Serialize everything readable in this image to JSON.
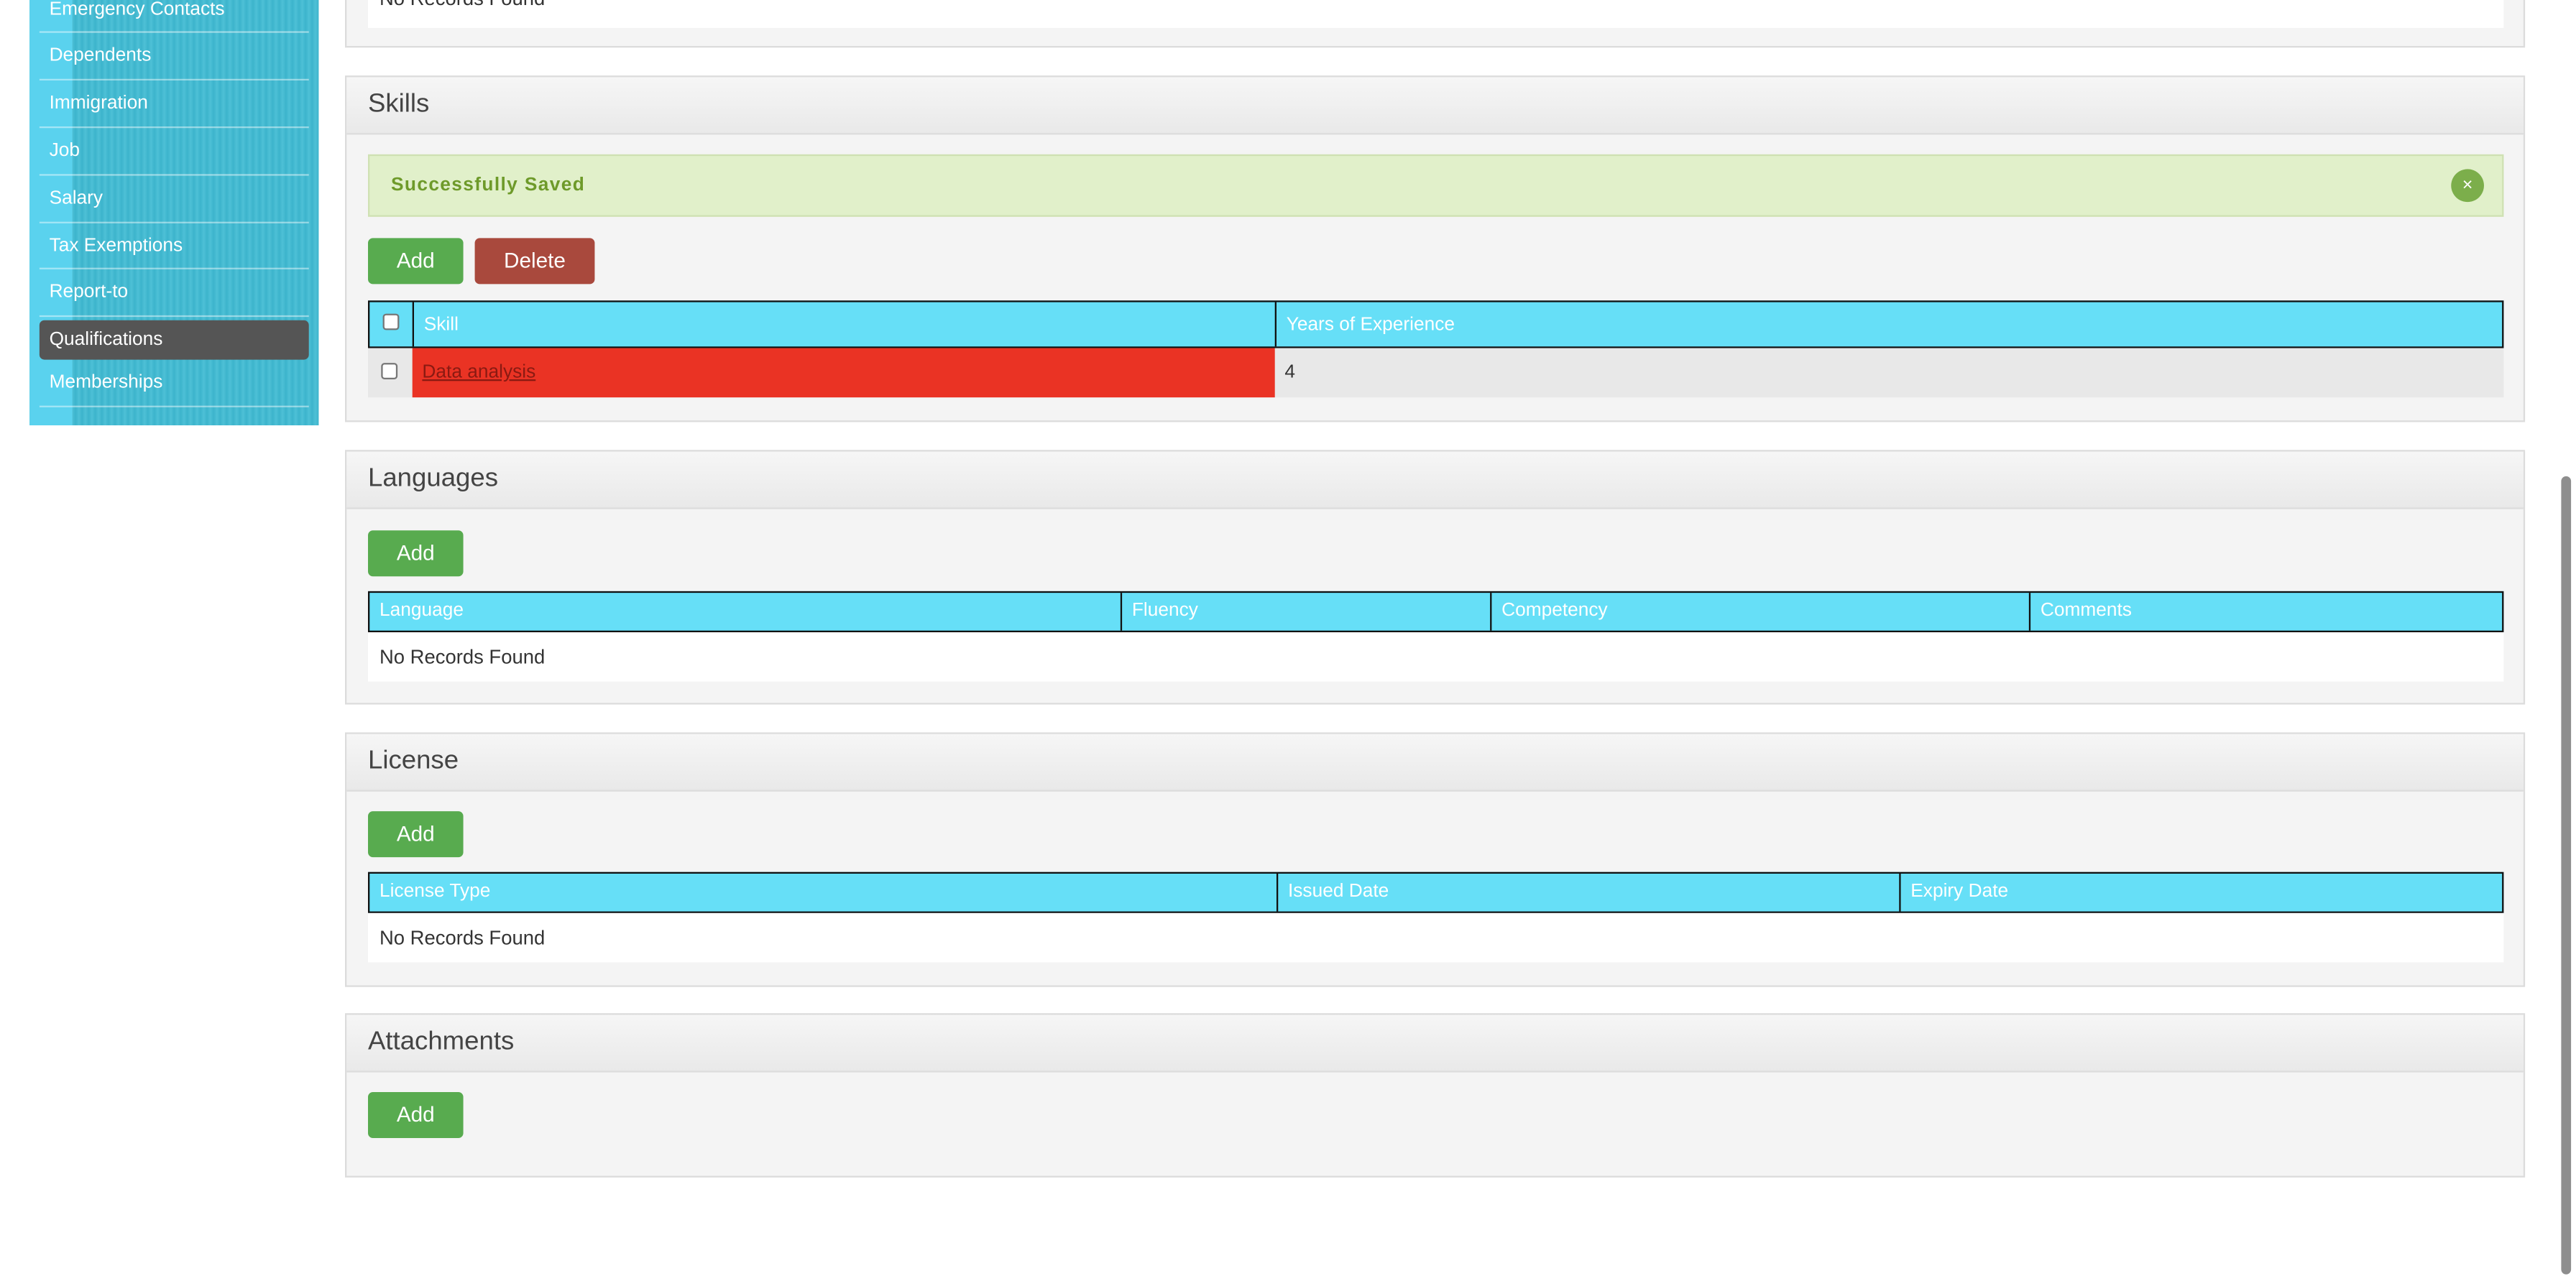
{
  "sidebar": {
    "items": [
      {
        "label": "Emergency Contacts"
      },
      {
        "label": "Dependents"
      },
      {
        "label": "Immigration"
      },
      {
        "label": "Job"
      },
      {
        "label": "Salary"
      },
      {
        "label": "Tax Exemptions"
      },
      {
        "label": "Report-to"
      },
      {
        "label": "Qualifications",
        "active": true
      },
      {
        "label": "Memberships"
      }
    ]
  },
  "top_panel": {
    "no_records": "No Records Found"
  },
  "skills": {
    "title": "Skills",
    "message": "Successfully Saved",
    "close_symbol": "×",
    "add_label": "Add",
    "delete_label": "Delete",
    "columns": [
      "Skill",
      "Years of Experience"
    ],
    "rows": [
      {
        "skill": "Data analysis",
        "years": "4"
      }
    ]
  },
  "languages": {
    "title": "Languages",
    "add_label": "Add",
    "columns": [
      "Language",
      "Fluency",
      "Competency",
      "Comments"
    ],
    "no_records": "No Records Found"
  },
  "license": {
    "title": "License",
    "add_label": "Add",
    "columns": [
      "License Type",
      "Issued Date",
      "Expiry Date"
    ],
    "no_records": "No Records Found"
  },
  "attachments": {
    "title": "Attachments",
    "add_label": "Add"
  },
  "colors": {
    "accent_cyan": "#66dff7",
    "add_green": "#58ab4f",
    "delete_red": "#a9493d",
    "highlight_red": "#ea3324",
    "success_bg": "#e1f0ca"
  }
}
